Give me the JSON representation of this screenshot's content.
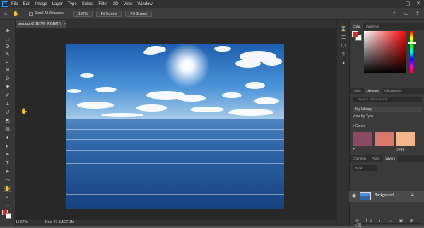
{
  "menu": {
    "app_icon": "Ps",
    "items": [
      "File",
      "Edit",
      "Image",
      "Layer",
      "Type",
      "Select",
      "Filter",
      "3D",
      "View",
      "Window"
    ],
    "window_controls": {
      "minimize": "–",
      "maximize": "▢",
      "close": "✕"
    }
  },
  "options": {
    "scroll_all_label": "Scroll All Windows",
    "zoom_value": "100%",
    "fit_screen_label": "Fit Screen",
    "fill_screen_label": "Fill Screen"
  },
  "document": {
    "tab_title": "sea.jpg @ 16.7% (RGB/8*)",
    "close": "×"
  },
  "status": {
    "zoom": "16.67%",
    "doc_size": "Doc: 27.1M/27.1M"
  },
  "panels": {
    "color_tabs": [
      "Color",
      "Swatches"
    ],
    "libraries_tabs": [
      "Learn",
      "Libraries",
      "Adjustments"
    ],
    "search_placeholder": "Search Adobe Stock",
    "library_name": "My Library",
    "view_by": "View by Type",
    "colors_heading": "Colors",
    "storage": "2 MB",
    "layers_tabs": [
      "Channels",
      "Paths",
      "Layers"
    ],
    "kind_placeholder": "Kind",
    "layer_name": "Background"
  },
  "colors": {
    "foreground": "#e02a1a",
    "background": "#ffffff",
    "library_swatches": [
      "#8a4a62",
      "#d9776a",
      "#f5b58a"
    ]
  },
  "icons": {
    "tools": [
      "move-icon",
      "marquee-icon",
      "lasso-icon",
      "quick-select-icon",
      "crop-icon",
      "frame-icon",
      "eyedropper-icon",
      "healing-icon",
      "brush-icon",
      "stamp-icon",
      "history-brush-icon",
      "eraser-icon",
      "gradient-icon",
      "blur-icon",
      "dodge-icon",
      "pen-icon",
      "type-icon",
      "path-select-icon",
      "shape-icon",
      "hand-icon",
      "zoom-icon",
      "more-icon"
    ]
  }
}
